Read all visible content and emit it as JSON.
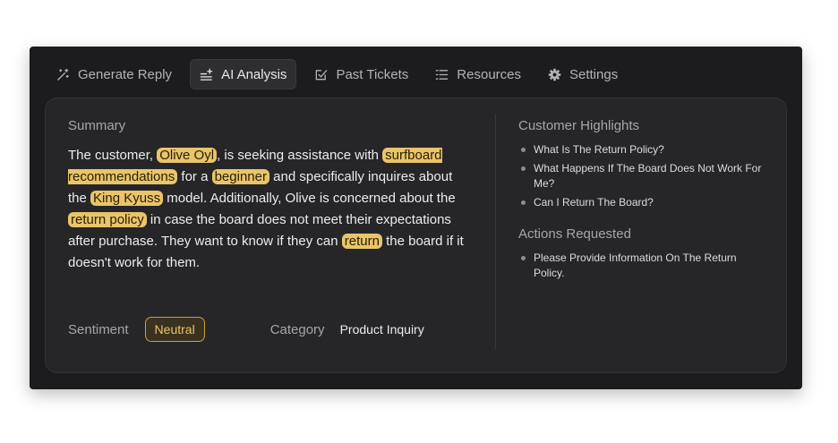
{
  "tabs": [
    {
      "label": "Generate Reply",
      "icon": "magic-wand-icon",
      "active": false
    },
    {
      "label": "AI Analysis",
      "icon": "sparkle-list-icon",
      "active": true
    },
    {
      "label": "Past Tickets",
      "icon": "edit-check-icon",
      "active": false
    },
    {
      "label": "Resources",
      "icon": "list-icon",
      "active": false
    },
    {
      "label": "Settings",
      "icon": "gear-icon",
      "active": false
    }
  ],
  "summary": {
    "label": "Summary",
    "parts": [
      "The customer, ",
      "Olive Oyl",
      ", is seeking assistance with ",
      "surfboard recommendations",
      " for a ",
      "beginner",
      " and specifically inquires about the ",
      "King Kyuss",
      " model. Additionally, Olive is concerned about the ",
      "return policy",
      " in case the board does not meet their expectations after purchase. They want to know if they can ",
      "return",
      " the board if it doesn't work for them."
    ],
    "highlight_color": "#e9c46a"
  },
  "sentiment": {
    "label": "Sentiment",
    "value": "Neutral"
  },
  "category": {
    "label": "Category",
    "value": "Product Inquiry"
  },
  "highlights": {
    "label": "Customer Highlights",
    "items": [
      "What Is The Return Policy?",
      "What Happens If The Board Does Not Work For Me?",
      "Can I Return The Board?"
    ]
  },
  "actions": {
    "label": "Actions Requested",
    "items": [
      "Please Provide Information On The Return Policy."
    ]
  }
}
